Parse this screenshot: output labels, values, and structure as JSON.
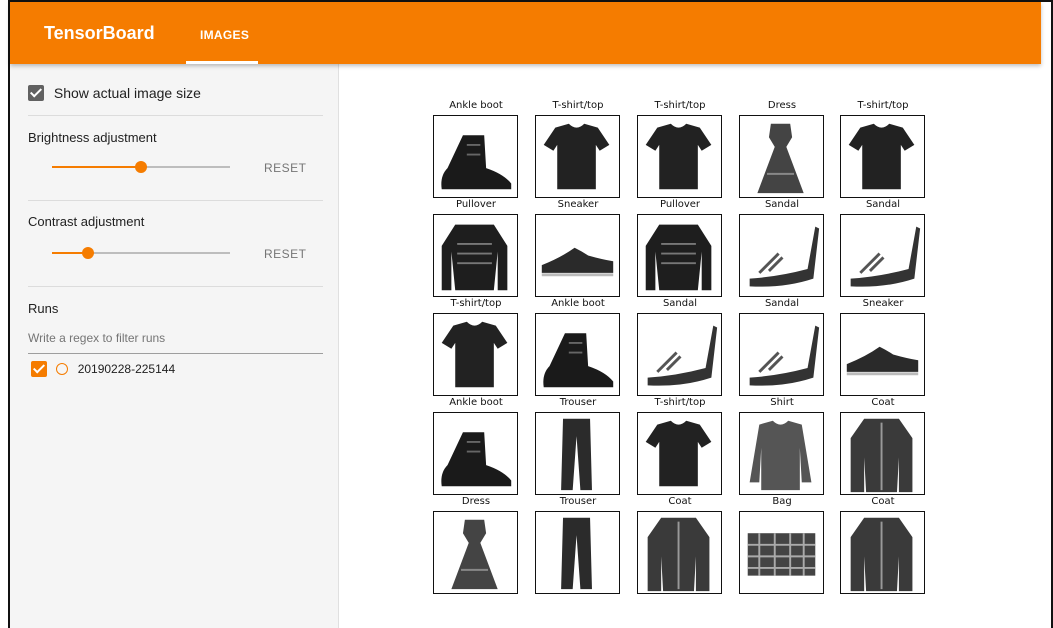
{
  "header": {
    "brand": "TensorBoard",
    "tab_label": "IMAGES",
    "accent_color": "#f57c00"
  },
  "sidebar": {
    "show_actual_size": {
      "label": "Show actual image size",
      "checked": true
    },
    "brightness": {
      "title": "Brightness adjustment",
      "reset_label": "RESET",
      "value": 0.5
    },
    "contrast": {
      "title": "Contrast adjustment",
      "reset_label": "RESET",
      "value": 0.2
    },
    "runs": {
      "title": "Runs",
      "filter_placeholder": "Write a regex to filter runs",
      "items": [
        {
          "label": "20190228-225144",
          "checked": true
        }
      ]
    }
  },
  "grid": {
    "labels": [
      [
        "Ankle boot",
        "T-shirt/top",
        "T-shirt/top",
        "Dress",
        "T-shirt/top"
      ],
      [
        "Pullover",
        "Sneaker",
        "Pullover",
        "Sandal",
        "Sandal"
      ],
      [
        "T-shirt/top",
        "Ankle boot",
        "Sandal",
        "Sandal",
        "Sneaker"
      ],
      [
        "Ankle boot",
        "Trouser",
        "T-shirt/top",
        "Shirt",
        "Coat"
      ],
      [
        "Dress",
        "Trouser",
        "Coat",
        "Bag",
        "Coat"
      ]
    ]
  }
}
